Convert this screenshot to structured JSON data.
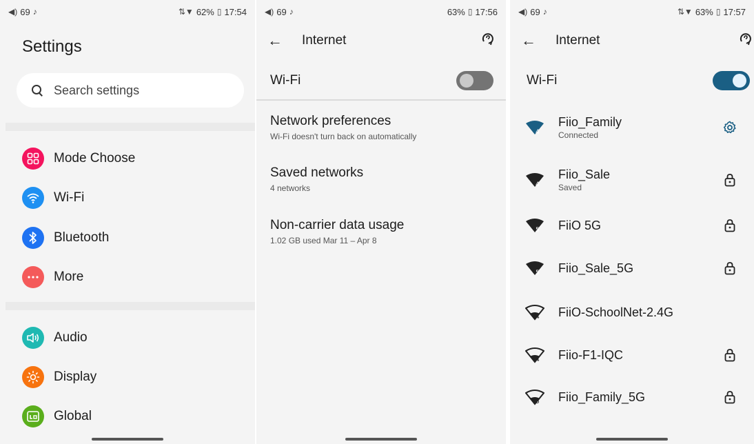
{
  "panel1": {
    "status": {
      "left": "69",
      "battery": "62%",
      "time": "17:54"
    },
    "title": "Settings",
    "search": {
      "placeholder": "Search settings"
    },
    "items": [
      {
        "label": "Mode Choose",
        "icon": "grid-icon",
        "color": "#f4145e"
      },
      {
        "label": "Wi-Fi",
        "icon": "wifi-icon",
        "color": "#1e90f2"
      },
      {
        "label": "Bluetooth",
        "icon": "bluetooth-icon",
        "color": "#1e72f2"
      },
      {
        "label": "More",
        "icon": "more-dots-icon",
        "color": "#f45a5a"
      },
      {
        "label": "Audio",
        "icon": "speaker-icon",
        "color": "#1fb9b2"
      },
      {
        "label": "Display",
        "icon": "brightness-icon",
        "color": "#f7730f"
      },
      {
        "label": "Global",
        "icon": "global-icon",
        "color": "#5aae1c"
      }
    ]
  },
  "panel2": {
    "status": {
      "left": "69",
      "battery": "63%",
      "time": "17:56"
    },
    "header": {
      "title": "Internet"
    },
    "wifi": {
      "label": "Wi-Fi",
      "enabled": false
    },
    "prefs": [
      {
        "title": "Network preferences",
        "subtitle": "Wi-Fi doesn't turn back on automatically"
      },
      {
        "title": "Saved networks",
        "subtitle": "4 networks"
      },
      {
        "title": "Non-carrier data usage",
        "subtitle": "1.02 GB used Mar 11 – Apr 8"
      }
    ]
  },
  "panel3": {
    "status": {
      "left": "69",
      "battery": "63%",
      "time": "17:57"
    },
    "header": {
      "title": "Internet"
    },
    "wifi": {
      "label": "Wi-Fi",
      "enabled": true
    },
    "networks": [
      {
        "name": "Fiio_Family",
        "status": "Connected",
        "band": "4",
        "action": "gear-icon"
      },
      {
        "name": "Fiio_Sale",
        "status": "Saved",
        "band": "4",
        "action": "lock-icon"
      },
      {
        "name": "FiiO 5G",
        "status": "",
        "band": "5",
        "action": "lock-icon"
      },
      {
        "name": "Fiio_Sale_5G",
        "status": "",
        "band": "5",
        "action": "lock-icon"
      },
      {
        "name": "FiiO-SchoolNet-2.4G",
        "status": "",
        "band": "4",
        "action": ""
      },
      {
        "name": "Fiio-F1-IQC",
        "status": "",
        "band": "4",
        "action": "lock-icon"
      },
      {
        "name": "Fiio_Family_5G",
        "status": "",
        "band": "5",
        "action": "lock-icon"
      }
    ]
  },
  "colors": {
    "accent": "#1a5f84",
    "toggle_off": "#747474"
  }
}
